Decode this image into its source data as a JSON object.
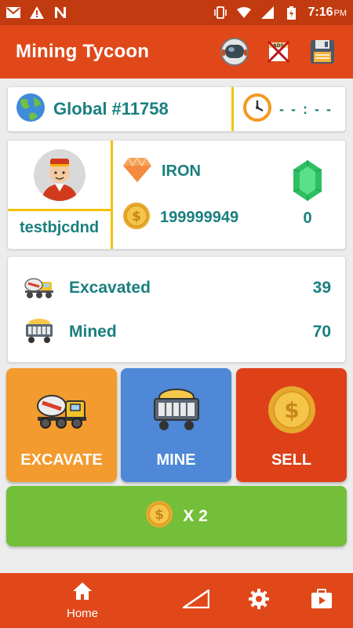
{
  "status_bar": {
    "time": "7:16",
    "ampm": "PM"
  },
  "app_bar": {
    "title": "Mining Tycoon",
    "actions": [
      "astronaut-icon",
      "no-ads-icon",
      "save-icon"
    ]
  },
  "global": {
    "label": "Global #11758",
    "timer": "- - : - -"
  },
  "profile": {
    "username": "testbjcdnd",
    "resource": "IRON",
    "coins": "199999949",
    "gems": "0"
  },
  "stats": [
    {
      "label": "Excavated",
      "value": "39",
      "icon": "cement-truck-icon"
    },
    {
      "label": "Mined",
      "value": "70",
      "icon": "mine-cart-icon"
    }
  ],
  "actions": {
    "excavate": "EXCAVATE",
    "mine": "MINE",
    "sell": "SELL"
  },
  "multiplier": {
    "label": "X 2"
  },
  "bottom_nav": {
    "home": "Home",
    "items": [
      "home-icon",
      "upgrade-icon",
      "settings-icon",
      "video-icon"
    ]
  },
  "colors": {
    "primary": "#e0481a",
    "status_bar": "#c23a0f",
    "excavate": "#f39b2e",
    "mine": "#4e88d6",
    "sell": "#de4018",
    "multiplier": "#73bf3a",
    "text_teal": "#1a7f7f",
    "accent_line": "#f2c200"
  }
}
